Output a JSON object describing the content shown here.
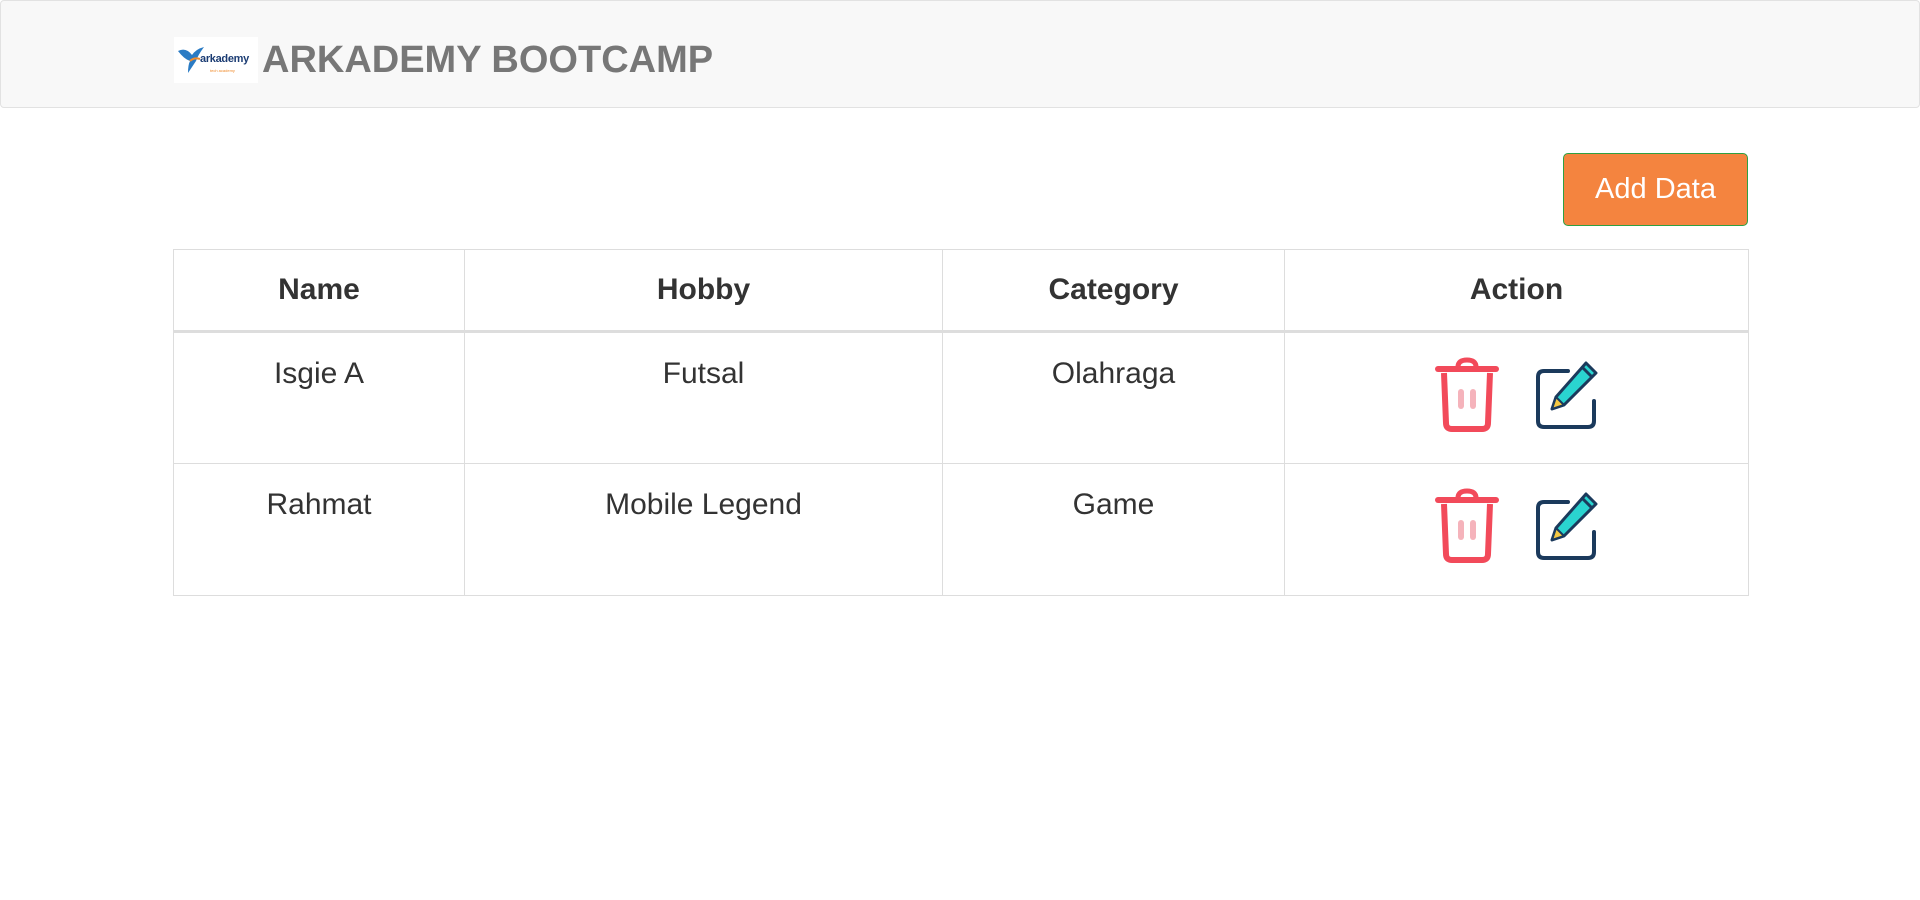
{
  "header": {
    "logo_text": "arkademy",
    "logo_subtext": "tech academy",
    "title": "ARKADEMY BOOTCAMP"
  },
  "toolbar": {
    "add_label": "Add Data"
  },
  "table": {
    "columns": [
      "Name",
      "Hobby",
      "Category",
      "Action"
    ],
    "rows": [
      {
        "name": "Isgie A",
        "hobby": "Futsal",
        "category": "Olahraga"
      },
      {
        "name": "Rahmat",
        "hobby": "Mobile Legend",
        "category": "Game"
      }
    ]
  },
  "icons": {
    "delete": "trash-icon",
    "edit": "edit-pencil-icon"
  },
  "colors": {
    "navbar_bg": "#f8f8f8",
    "brand_text": "#777777",
    "add_button": "#f4843f",
    "trash": "#f24a5a",
    "edit_frame": "#1b3a5c",
    "edit_pencil": "#2ad4d0"
  }
}
